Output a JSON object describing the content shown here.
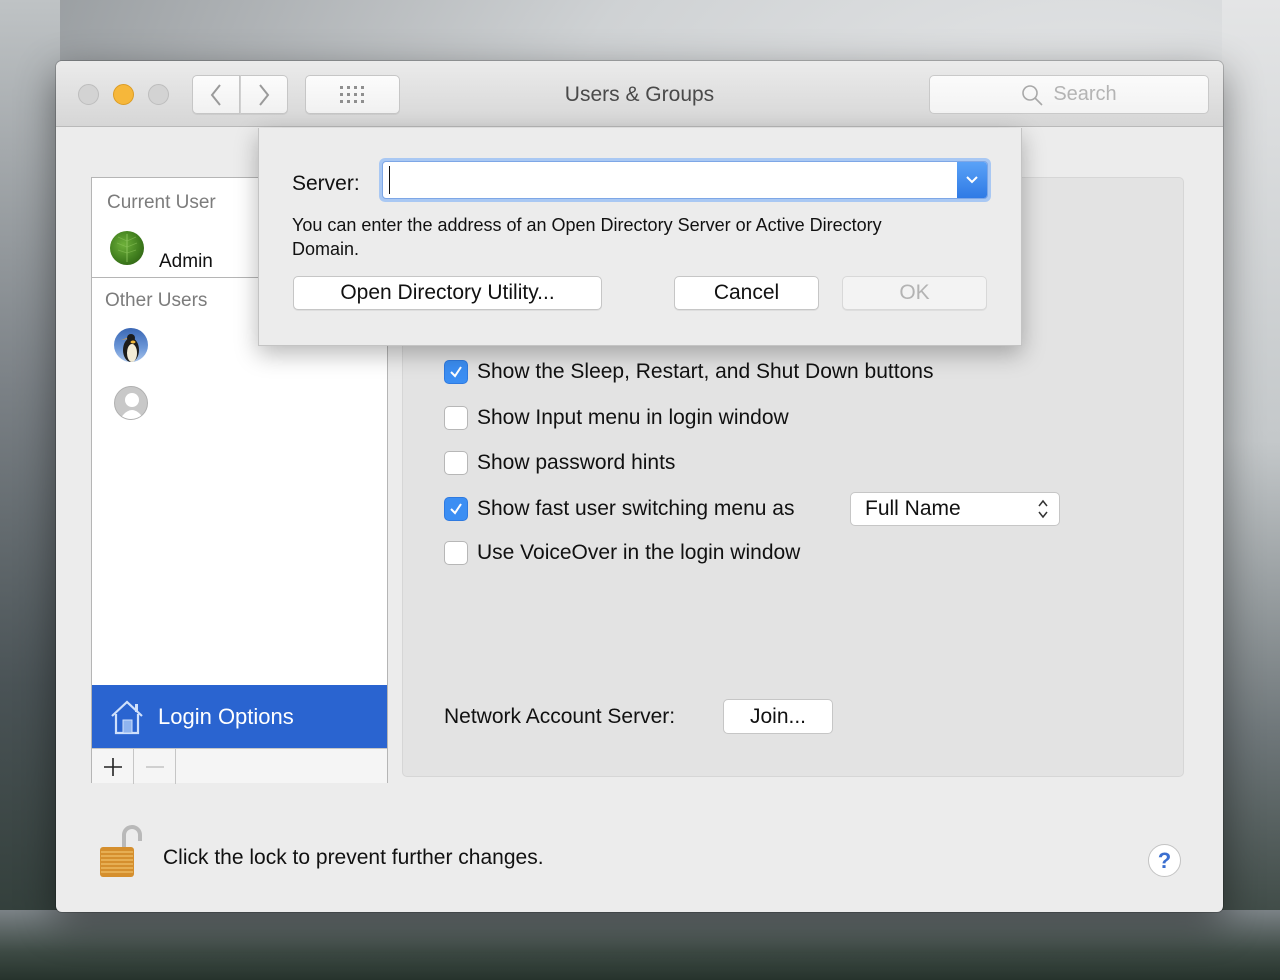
{
  "window": {
    "title": "Users & Groups",
    "search_placeholder": "Search",
    "colors": {
      "accent": "#2a64d0",
      "checkbox": "#3b8ef3",
      "minimize": "#f6b73a"
    }
  },
  "sidebar": {
    "current_user_label": "Current User",
    "current_user": {
      "name": "Admin",
      "avatar": "leaf-avatar"
    },
    "other_users_label": "Other Users",
    "other_users": [
      {
        "avatar": "penguin-avatar"
      },
      {
        "avatar": "generic-user-avatar"
      }
    ],
    "login_options_label": "Login Options",
    "add_label": "+",
    "remove_label": "−"
  },
  "options": {
    "checkboxes": [
      {
        "label": "Show the Sleep, Restart, and Shut Down buttons",
        "checked": true
      },
      {
        "label": "Show Input menu in login window",
        "checked": false
      },
      {
        "label": "Show password hints",
        "checked": false
      },
      {
        "label": "Show fast user switching menu as",
        "checked": true
      },
      {
        "label": "Use VoiceOver in the login window",
        "checked": false
      }
    ],
    "fast_user_switching_value": "Full Name",
    "network_account_server_label": "Network Account Server:",
    "join_label": "Join..."
  },
  "footer": {
    "lock_text": "Click the lock to prevent further changes.",
    "help_label": "?"
  },
  "sheet": {
    "server_label": "Server:",
    "server_value": "",
    "help_text": "You can enter the address of an Open Directory Server or Active Directory Domain.",
    "open_directory_utility_label": "Open Directory Utility...",
    "cancel_label": "Cancel",
    "ok_label": "OK",
    "ok_enabled": false
  }
}
